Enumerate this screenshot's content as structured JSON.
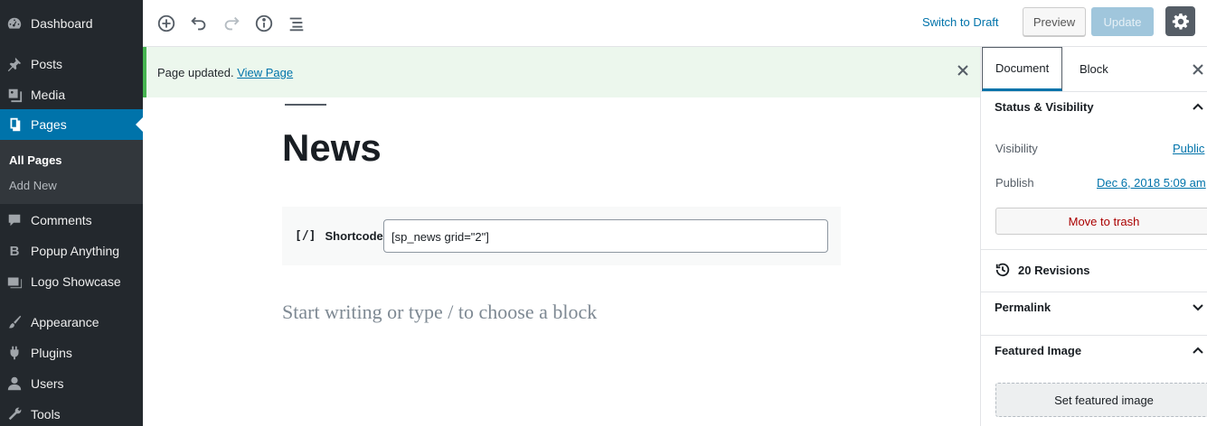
{
  "admin_menu": {
    "items": [
      {
        "label": "Dashboard",
        "icon": "dashboard-icon"
      },
      {
        "label": "Posts",
        "icon": "pin-icon"
      },
      {
        "label": "Media",
        "icon": "media-icon"
      },
      {
        "label": "Pages",
        "icon": "pages-icon"
      },
      {
        "label": "Comments",
        "icon": "comments-icon"
      },
      {
        "label": "Popup Anything",
        "icon": "b-icon"
      },
      {
        "label": "Logo Showcase",
        "icon": "gallery-icon"
      },
      {
        "label": "Appearance",
        "icon": "brush-icon"
      },
      {
        "label": "Plugins",
        "icon": "plugin-icon"
      },
      {
        "label": "Users",
        "icon": "user-icon"
      },
      {
        "label": "Tools",
        "icon": "wrench-icon"
      }
    ],
    "submenu": {
      "all_pages": "All Pages",
      "add_new": "Add New"
    }
  },
  "toolbar": {
    "switch_to_draft": "Switch to Draft",
    "preview": "Preview",
    "update": "Update"
  },
  "notice": {
    "text": "Page updated.",
    "link": "View Page"
  },
  "editor": {
    "title": "News",
    "shortcode_icon": "[/]",
    "shortcode_label": "Shortcode",
    "shortcode_value": "[sp_news grid=\"2\"]",
    "placeholder": "Start writing or type / to choose a block"
  },
  "settings": {
    "tabs": {
      "document": "Document",
      "block": "Block"
    },
    "status_visibility": "Status & Visibility",
    "visibility_label": "Visibility",
    "visibility_value": "Public",
    "publish_label": "Publish",
    "publish_value": "Dec 6, 2018 5:09 am",
    "move_to_trash": "Move to trash",
    "revisions": "20 Revisions",
    "permalink": "Permalink",
    "featured_image": "Featured Image",
    "set_featured_image": "Set featured image"
  }
}
